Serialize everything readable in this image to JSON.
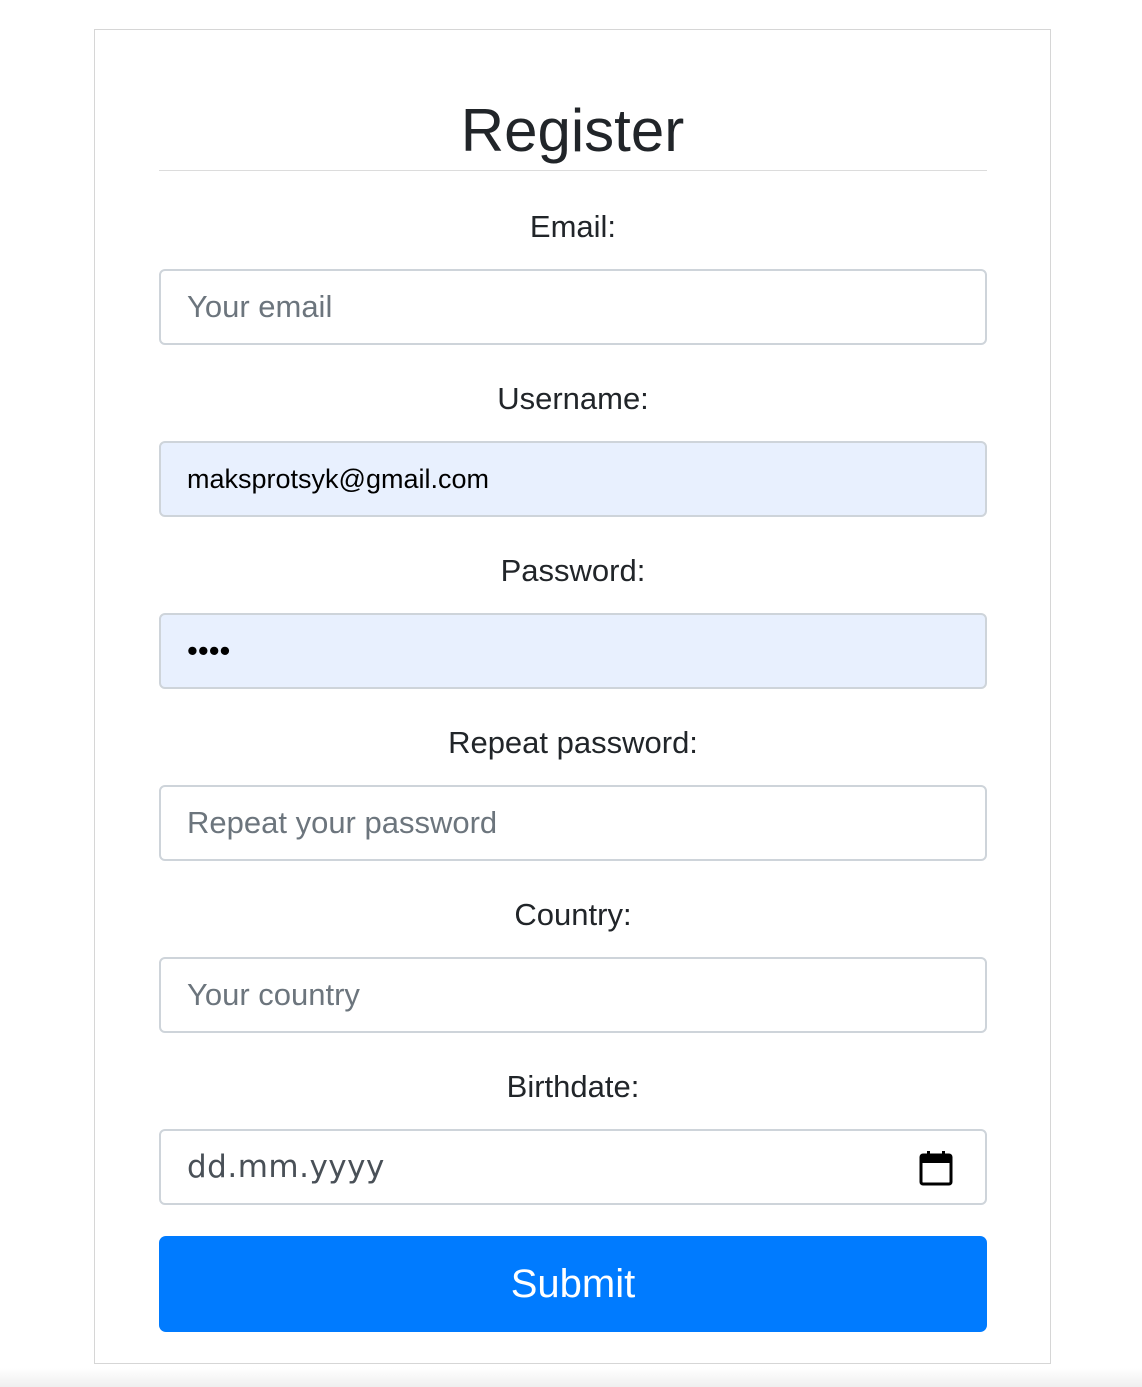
{
  "form": {
    "title": "Register",
    "fields": {
      "email": {
        "label": "Email:",
        "placeholder": "Your email",
        "value": ""
      },
      "username": {
        "label": "Username:",
        "placeholder": "",
        "value": "maksprotsyk@gmail.com"
      },
      "password": {
        "label": "Password:",
        "placeholder": "",
        "value": "••••"
      },
      "repeat_password": {
        "label": "Repeat password:",
        "placeholder": "Repeat your password",
        "value": ""
      },
      "country": {
        "label": "Country:",
        "placeholder": "Your country",
        "value": ""
      },
      "birthdate": {
        "label": "Birthdate:",
        "placeholder": "dd.mm.yyyy",
        "icon": "calendar-icon"
      }
    },
    "submit_label": "Submit"
  },
  "colors": {
    "accent": "#007bff",
    "autofill_background": "#e8f0fe",
    "border": "#ced4da"
  }
}
